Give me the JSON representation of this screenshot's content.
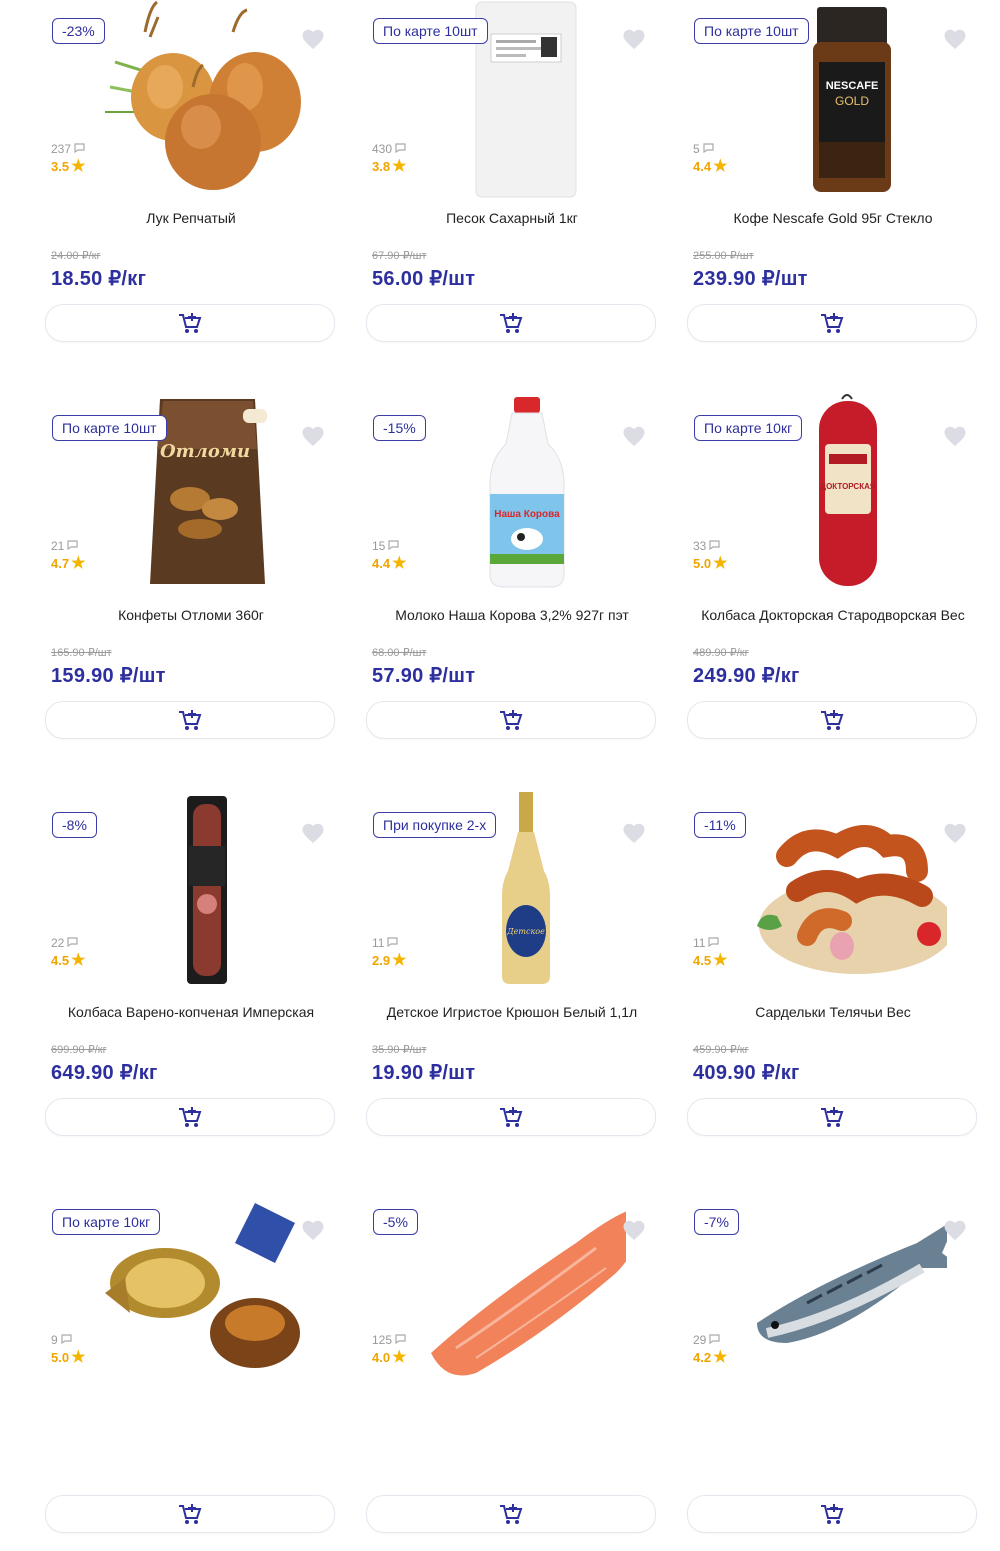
{
  "ui": {
    "accent": "#2d2f9e",
    "star_color": "#f5b400",
    "heart_color": "#dcdce4"
  },
  "products": [
    {
      "badge": "-23%",
      "reviews": "237",
      "rating": "3.5",
      "name": "Лук Репчатый",
      "old_price": "24.00 ₽/кг",
      "price": "18.50 ₽/кг",
      "image": "onion"
    },
    {
      "badge": "По карте 10шт",
      "reviews": "430",
      "rating": "3.8",
      "name": "Песок Сахарный 1кг",
      "old_price": "67.90 ₽/шт",
      "price": "56.00 ₽/шт",
      "image": "sugar-bag"
    },
    {
      "badge": "По карте 10шт",
      "reviews": "5",
      "rating": "4.4",
      "name": "Кофе Nescafe Gold 95г Стекло",
      "old_price": "255.00 ₽/шт",
      "price": "239.90 ₽/шт",
      "image": "coffee-jar",
      "image_text": "NESCAFE GOLD"
    },
    {
      "badge": "По карте 10шт",
      "reviews": "21",
      "rating": "4.7",
      "name": "Конфеты Отломи 360г",
      "old_price": "165.90 ₽/шт",
      "price": "159.90 ₽/шт",
      "image": "candy-pack",
      "image_text": "Отломи"
    },
    {
      "badge": "-15%",
      "reviews": "15",
      "rating": "4.4",
      "name": "Молоко Наша Корова 3,2% 927г пэт",
      "old_price": "68.00 ₽/шт",
      "price": "57.90 ₽/шт",
      "image": "milk-bottle",
      "image_text": "Наша Корова"
    },
    {
      "badge": "По карте 10кг",
      "reviews": "33",
      "rating": "5.0",
      "name": "Колбаса Докторская Стародворская Вес",
      "old_price": "489.90 ₽/кг",
      "price": "249.90 ₽/кг",
      "image": "sausage-red",
      "image_text": "ДОКТОРСКАЯ"
    },
    {
      "badge": "-8%",
      "reviews": "22",
      "rating": "4.5",
      "name": "Колбаса Варено-копченая Имперская",
      "old_price": "699.90 ₽/кг",
      "price": "649.90 ₽/кг",
      "image": "sausage-dark"
    },
    {
      "badge": "При покупке 2-х",
      "reviews": "11",
      "rating": "2.9",
      "name": "Детское Игристое Крюшон Белый 1,1л",
      "old_price": "35.90 ₽/шт",
      "price": "19.90 ₽/шт",
      "image": "bottle"
    },
    {
      "badge": "-11%",
      "reviews": "11",
      "rating": "4.5",
      "name": "Сардельки Телячьи Вес",
      "old_price": "459.90 ₽/кг",
      "price": "409.90 ₽/кг",
      "image": "sardelki"
    },
    {
      "badge": "По карте 10кг",
      "reviews": "9",
      "rating": "5.0",
      "name": "",
      "old_price": "",
      "price": "",
      "image": "candies"
    },
    {
      "badge": "-5%",
      "reviews": "125",
      "rating": "4.0",
      "name": "",
      "old_price": "",
      "price": "",
      "image": "salmon"
    },
    {
      "badge": "-7%",
      "reviews": "29",
      "rating": "4.2",
      "name": "",
      "old_price": "",
      "price": "",
      "image": "mackerel"
    }
  ]
}
